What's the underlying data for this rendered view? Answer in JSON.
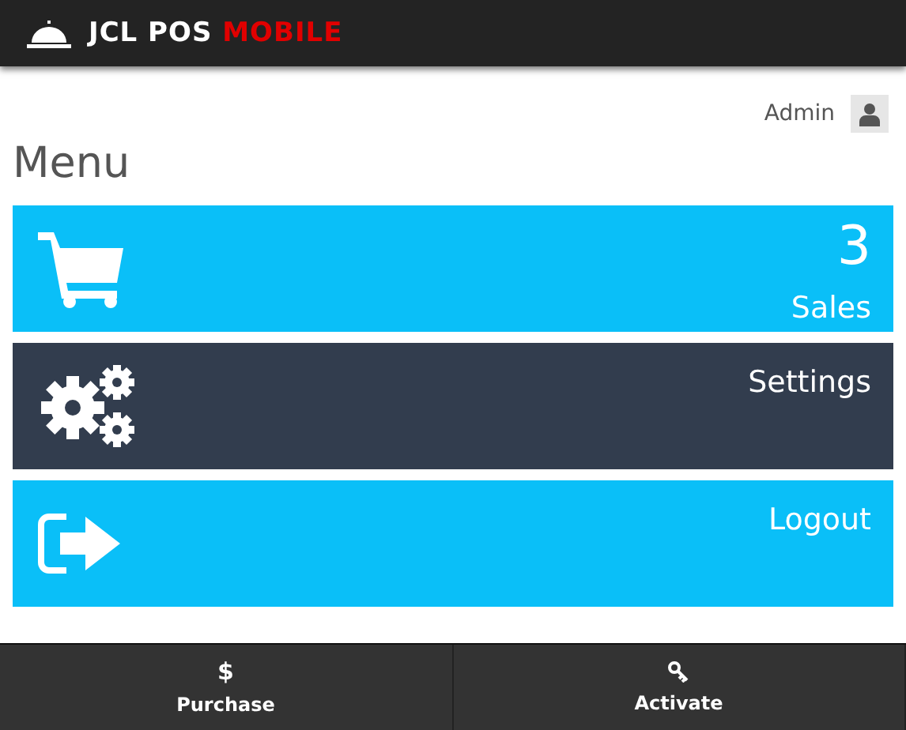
{
  "header": {
    "logo_text": "JCL POS",
    "logo_accent": "MOBILE"
  },
  "user": {
    "name": "Admin"
  },
  "title": "Menu",
  "tiles": [
    {
      "kind": "cart",
      "label": "Sales",
      "count": "3",
      "color": "#0abff8"
    },
    {
      "kind": "gears",
      "label": "Settings",
      "color": "#323d4e"
    },
    {
      "kind": "logout",
      "label": "Logout",
      "color": "#0abff8"
    }
  ],
  "footer": [
    {
      "kind": "dollar",
      "icon_text": "$",
      "label": "Purchase"
    },
    {
      "kind": "key",
      "label": "Activate"
    }
  ]
}
